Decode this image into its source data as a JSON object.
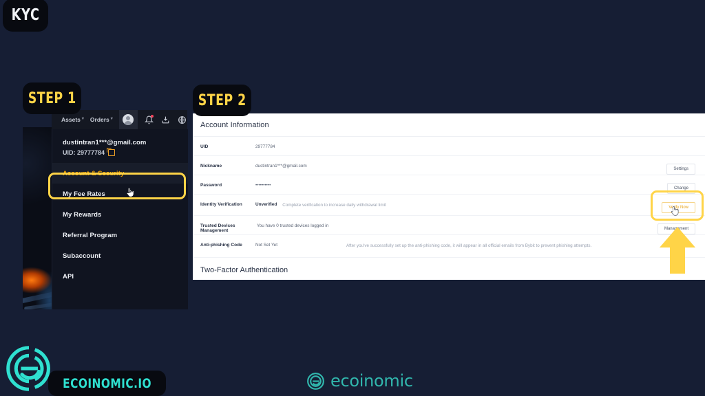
{
  "badges": {
    "kyc": "KYC",
    "step1": "STEP 1",
    "step2": "STEP 2"
  },
  "topnav": {
    "items": [
      {
        "label": "Assets",
        "caret": "▾",
        "icon": "assets-menu"
      },
      {
        "label": "Orders",
        "caret": "▾",
        "icon": "orders-menu"
      }
    ],
    "icons": [
      {
        "name": "avatar-icon"
      },
      {
        "name": "notification-bell-icon",
        "badge": true
      },
      {
        "name": "download-icon"
      },
      {
        "name": "language-globe-icon"
      }
    ]
  },
  "dropdown": {
    "email": "dustintran1***@gmail.com",
    "uid_label": "UID: 29777784",
    "copy_icon": "copy-icon",
    "items": [
      {
        "label": "Account & Security",
        "active": true
      },
      {
        "label": "My Fee Rates",
        "active": false
      },
      {
        "label": "My Rewards",
        "active": false
      },
      {
        "label": "Referral Program",
        "active": false
      },
      {
        "label": "Subaccount",
        "active": false
      },
      {
        "label": "API",
        "active": false
      }
    ]
  },
  "account_panel": {
    "title": "Account Information",
    "rows": [
      {
        "label": "UID",
        "value": "29777784",
        "note": "",
        "button": null
      },
      {
        "label": "Nickname",
        "value": "dustintran1***@gmail.com",
        "note": "",
        "button": "Settings"
      },
      {
        "label": "Password",
        "value": "••••••••••",
        "note": "",
        "button": "Change"
      },
      {
        "label": "Identity Verification",
        "value": "Unverified",
        "note": "Complete verification to increase daily withdrawal limit",
        "button": "Verify Now"
      },
      {
        "label": "Trusted Devices Management",
        "value": "You have 0 trusted devices logged in",
        "note": "",
        "button": "Management"
      },
      {
        "label": "Anti-phishing Code",
        "value": "Not Set Yet",
        "note": "After you've successfully set up the anti-phishing code, it will appear in all official emails from Bybit to prevent phishing attempts.",
        "button": null
      }
    ],
    "section_two_title": "Two-Factor Authentication"
  },
  "footer": {
    "left_wordmark": "ECOINOMIC.IO",
    "center_wordmark": "ecoinomic"
  },
  "colors": {
    "page_bg": "#161e34",
    "highlight_yellow": "#ffd447",
    "accent_orange": "#f7a600",
    "brand_teal": "#2fe0d0",
    "panel_dark": "#101420",
    "panel_light": "#ffffff"
  }
}
